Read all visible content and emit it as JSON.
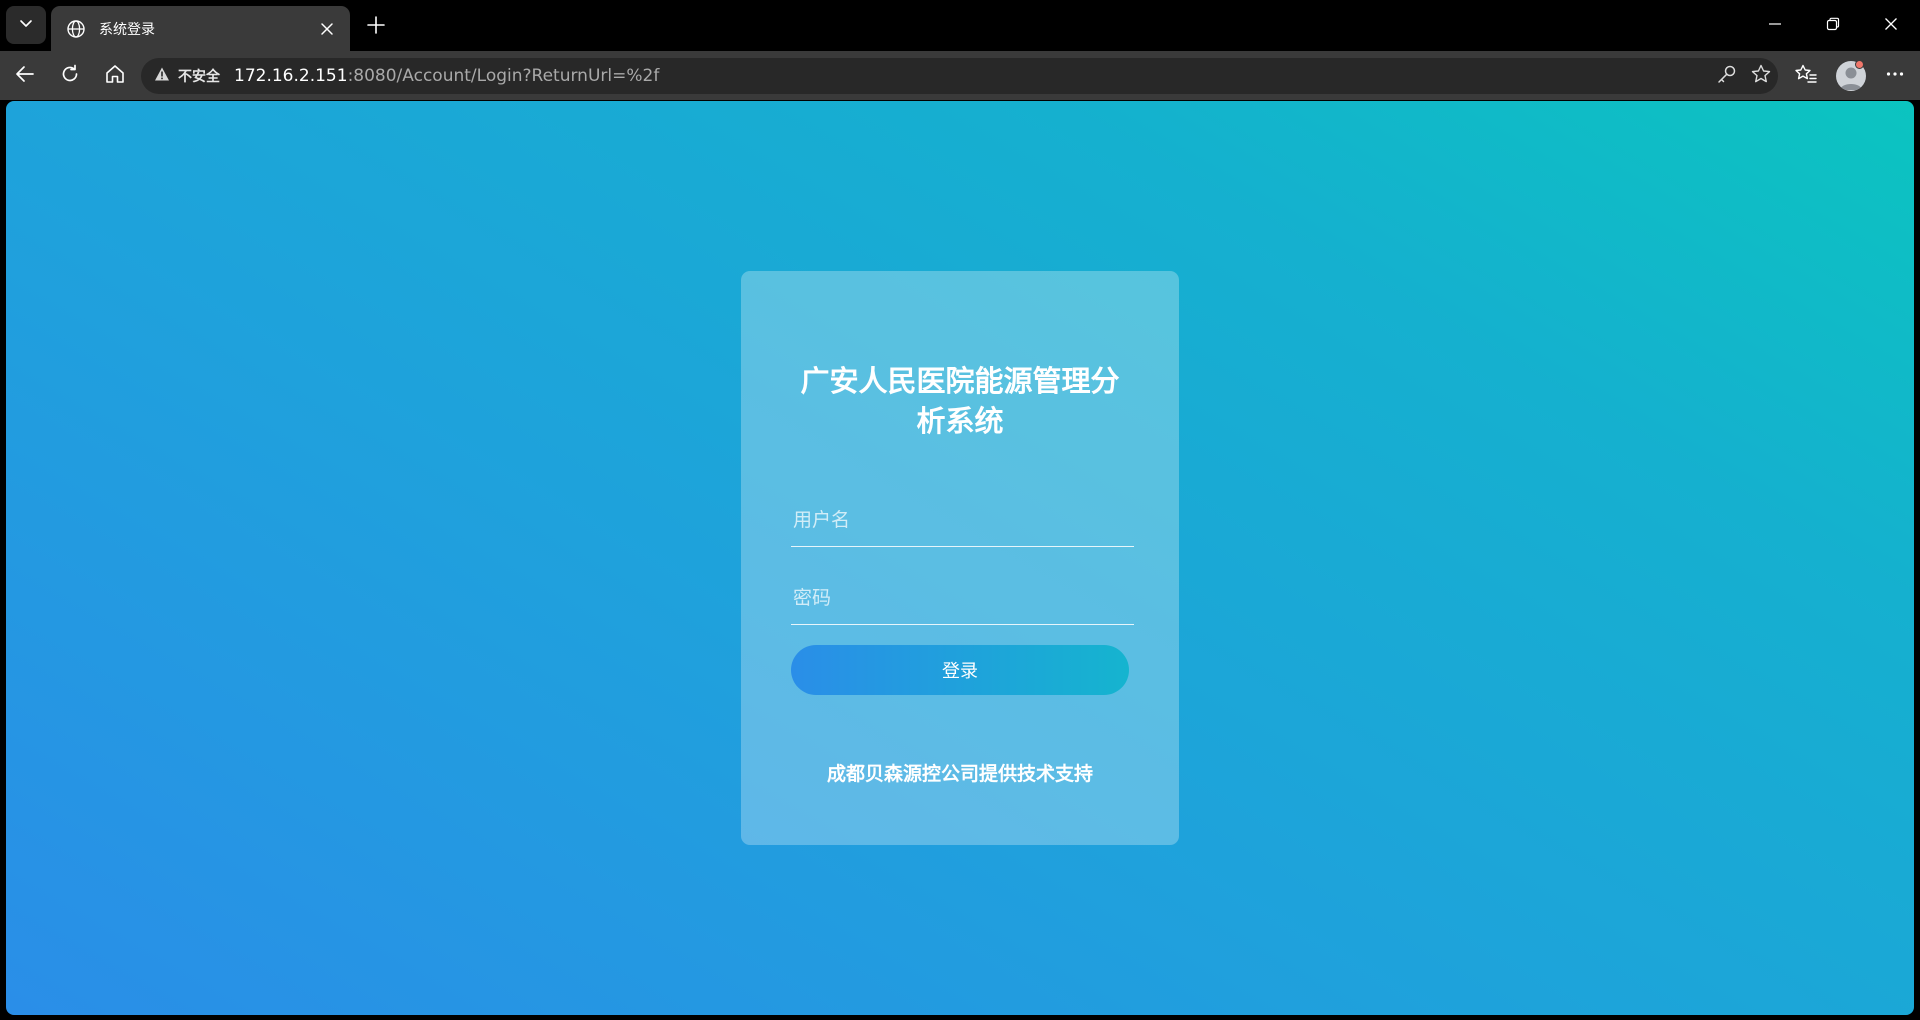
{
  "browser": {
    "tab": {
      "title": "系统登录"
    },
    "address": {
      "security_label": "不安全",
      "url_host": "172.16.2.151",
      "url_rest": ":8080/Account/Login?ReturnUrl=%2f"
    },
    "icons": {
      "tab_menu": "chevron-down-icon",
      "favicon": "globe-icon",
      "tab_close": "close-icon",
      "new_tab": "plus-icon",
      "back": "arrow-left-icon",
      "reload": "reload-icon",
      "home": "home-icon",
      "warning": "warning-icon",
      "password": "key-icon",
      "favorite": "star-icon",
      "favorites": "favorites-icon",
      "profile": "avatar",
      "more": "more-icon"
    }
  },
  "login": {
    "title": "广安人民医院能源管理分析系统",
    "username_placeholder": "用户名",
    "password_placeholder": "密码",
    "username_value": "",
    "password_value": "",
    "submit_label": "登录",
    "footer": "成都贝森源控公司提供技术支持"
  },
  "colors": {
    "background_start": "#2a8ee8",
    "background_end": "#0bc4c0",
    "button_start": "#2a8ee8",
    "button_end": "#15b4cf",
    "warning_dot": "#f0776b"
  }
}
